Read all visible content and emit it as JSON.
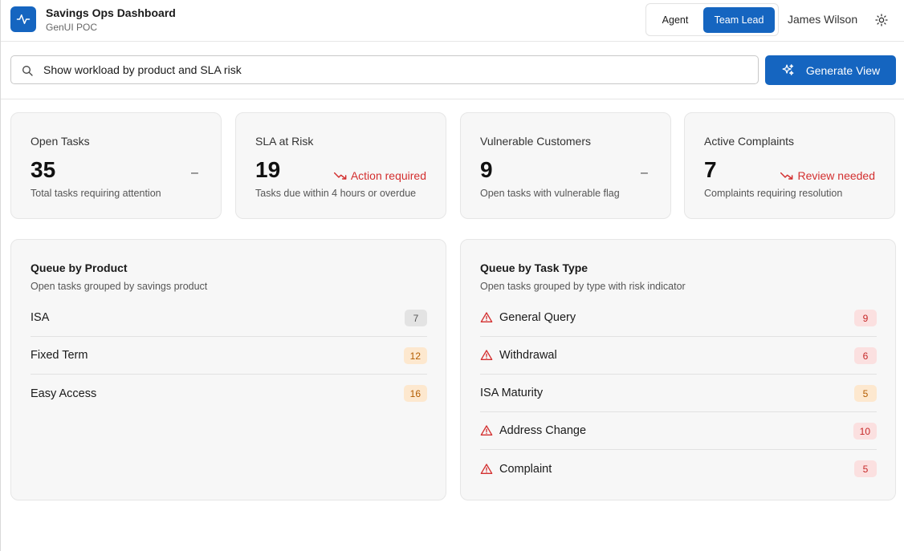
{
  "header": {
    "app_title": "Savings Ops Dashboard",
    "app_subtitle": "GenUI POC",
    "logo_icon": "activity-pulse-icon",
    "roles": [
      {
        "label": "Agent",
        "active": false
      },
      {
        "label": "Team Lead",
        "active": true
      }
    ],
    "user_name": "James Wilson",
    "theme_icon": "sun-icon"
  },
  "search": {
    "value": "Show workload by product and SLA risk",
    "placeholder": "",
    "icon": "search-icon",
    "button_label": "Generate View",
    "button_icon": "sparkle-icon"
  },
  "stats": [
    {
      "label": "Open Tasks",
      "value": "35",
      "description": "Total tasks requiring attention",
      "trend": "–",
      "trend_type": "neutral"
    },
    {
      "label": "SLA at Risk",
      "value": "19",
      "description": "Tasks due within 4 hours or overdue",
      "trend": "Action required",
      "trend_type": "down"
    },
    {
      "label": "Vulnerable Customers",
      "value": "9",
      "description": "Open tasks with vulnerable flag",
      "trend": "–",
      "trend_type": "neutral"
    },
    {
      "label": "Active Complaints",
      "value": "7",
      "description": "Complaints requiring resolution",
      "trend": "Review needed",
      "trend_type": "down"
    }
  ],
  "queue_by_product": {
    "title": "Queue by Product",
    "subtitle": "Open tasks grouped by savings product",
    "items": [
      {
        "label": "ISA",
        "count": "7",
        "level": "gray"
      },
      {
        "label": "Fixed Term",
        "count": "12",
        "level": "orange"
      },
      {
        "label": "Easy Access",
        "count": "16",
        "level": "orange"
      }
    ]
  },
  "queue_by_task_type": {
    "title": "Queue by Task Type",
    "subtitle": "Open tasks grouped by type with risk indicator",
    "items": [
      {
        "label": "General Query",
        "count": "9",
        "level": "red",
        "at_risk": true
      },
      {
        "label": "Withdrawal",
        "count": "6",
        "level": "red",
        "at_risk": true
      },
      {
        "label": "ISA Maturity",
        "count": "5",
        "level": "orange",
        "at_risk": false
      },
      {
        "label": "Address Change",
        "count": "10",
        "level": "red",
        "at_risk": true
      },
      {
        "label": "Complaint",
        "count": "5",
        "level": "red",
        "at_risk": true
      }
    ]
  },
  "colors": {
    "accent": "#1565c0",
    "danger": "#d32f2f",
    "card_bg": "#f7f7f7"
  }
}
